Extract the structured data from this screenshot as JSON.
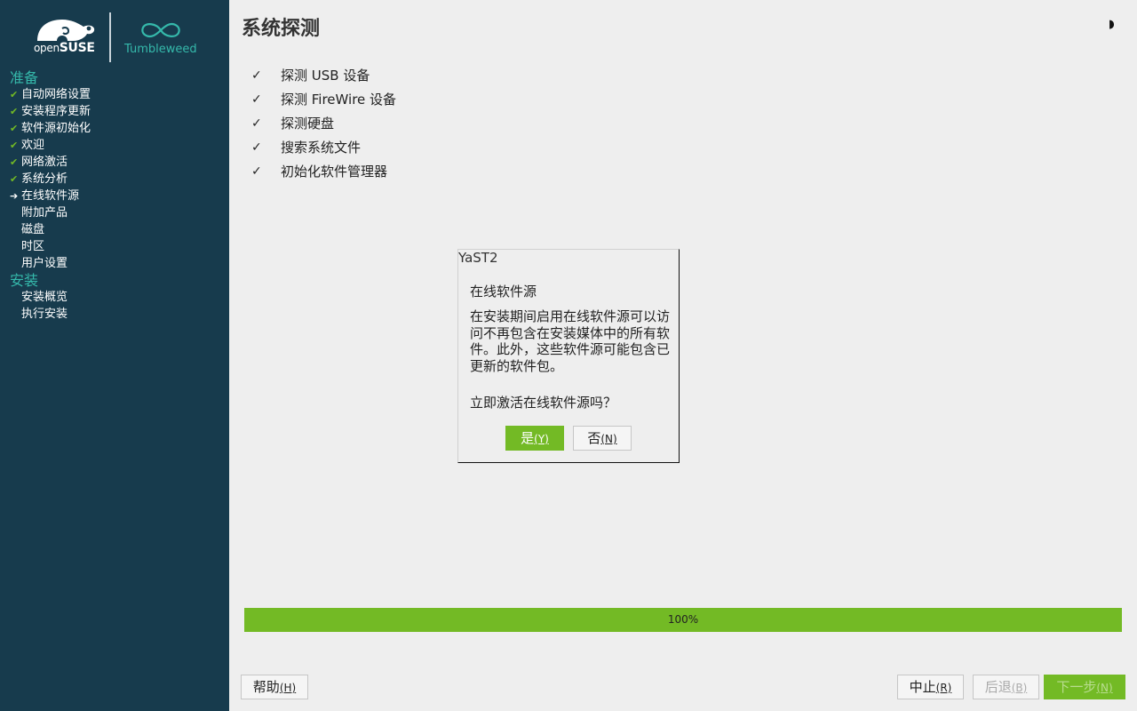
{
  "logo": {
    "brand_light": "open",
    "brand_bold": "SUSE",
    "edition": "Tumbleweed"
  },
  "sidebar": {
    "sections": [
      {
        "label": "准备",
        "steps": [
          {
            "label": "自动网络设置",
            "state": "done"
          },
          {
            "label": "安装程序更新",
            "state": "done"
          },
          {
            "label": "软件源初始化",
            "state": "done"
          },
          {
            "label": "欢迎",
            "state": "done"
          },
          {
            "label": "网络激活",
            "state": "done"
          },
          {
            "label": "系统分析",
            "state": "done"
          },
          {
            "label": "在线软件源",
            "state": "current"
          },
          {
            "label": "附加产品",
            "state": "pending"
          },
          {
            "label": "磁盘",
            "state": "pending"
          },
          {
            "label": "时区",
            "state": "pending"
          },
          {
            "label": "用户设置",
            "state": "pending"
          }
        ]
      },
      {
        "label": "安装",
        "steps": [
          {
            "label": "安装概览",
            "state": "pending"
          },
          {
            "label": "执行安装",
            "state": "pending"
          }
        ]
      }
    ]
  },
  "main": {
    "title": "系统探测",
    "theme_icon": "half-moon-icon",
    "probe_items": [
      {
        "label": "探测 USB 设备",
        "check": "✓"
      },
      {
        "label": "探测 FireWire 设备",
        "check": "✓"
      },
      {
        "label": "探测硬盘",
        "check": "✓"
      },
      {
        "label": "搜索系统文件",
        "check": "✓"
      },
      {
        "label": "初始化软件管理器",
        "check": "✓"
      }
    ]
  },
  "dialog": {
    "title": "YaST2",
    "heading": "在线软件源",
    "body": "在安装期间启用在线软件源可以访问不再包含在安装媒体中的所有软件。此外，这些软件源可能包含已更新的软件包。",
    "question": "立即激活在线软件源吗？",
    "yes_label": "是",
    "yes_hotkey": "(Y)",
    "no_label": "否",
    "no_hotkey": "(N)"
  },
  "progress": {
    "value": 1.0,
    "label": "100%"
  },
  "footer": {
    "help_label": "帮助",
    "help_hotkey": "(H)",
    "abort_label": "中止",
    "abort_hotkey": "(R)",
    "back_label": "后退",
    "back_hotkey": "(B)",
    "next_label": "下一步",
    "next_hotkey": "(N)"
  },
  "colors": {
    "sidebar_bg": "#173b4d",
    "accent_green": "#73ba25",
    "section_teal": "#35b9ab",
    "page_bg": "#eeeeee"
  }
}
